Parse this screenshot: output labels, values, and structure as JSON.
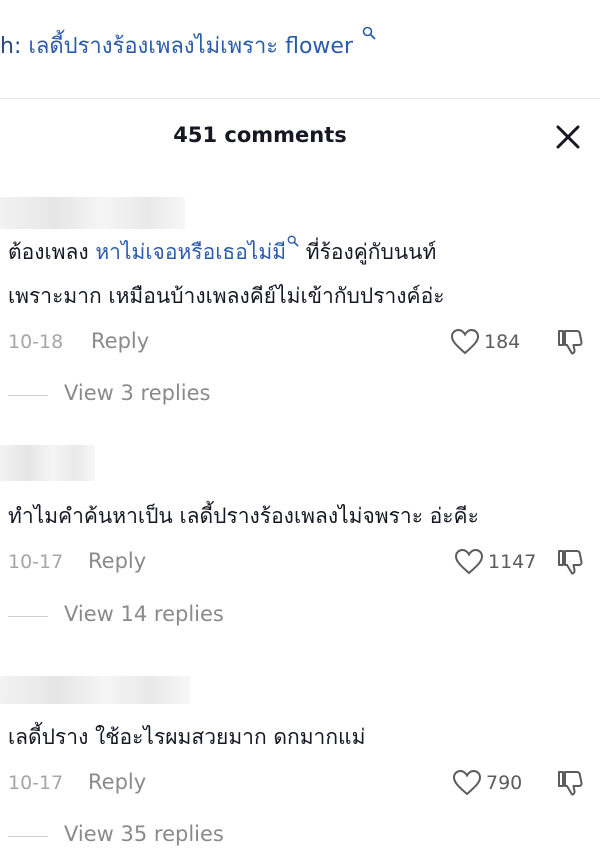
{
  "search": {
    "prefix": "h:",
    "query": "เลดี้ปรางร้องเพลงไม่เพราะ flower"
  },
  "comments_panel": {
    "title": "451 comments"
  },
  "comments": [
    {
      "text_part1": "ต้องเพลง ",
      "link": "หาไม่เจอหรือเธอไม่มี",
      "text_part2": " ที่ร้องคู่กับนนท์",
      "line2": "เพราะมาก เหมือนบ้างเพลงคีย์ไม่เข้ากับปรางค์อ่ะ",
      "date": "10-18",
      "reply_label": "Reply",
      "likes": "184",
      "view_replies": "View 3 replies"
    },
    {
      "text": "ทำไมคำค้นหาเป็น เลดี้ปรางร้องเพลงไม่จพราะ อ่ะคีะ",
      "date": "10-17",
      "reply_label": "Reply",
      "likes": "1147",
      "view_replies": "View 14 replies"
    },
    {
      "text": "เลดี้ปราง ใช้อะไรผมสวยมาก ดกมากแม่",
      "date": "10-17",
      "reply_label": "Reply",
      "likes": "790",
      "view_replies": "View 35 replies"
    }
  ],
  "colors": {
    "link": "#2b5cab",
    "muted": "#8a8a8a",
    "text": "#161823"
  },
  "icons": [
    "search-icon",
    "close-icon",
    "heart-icon",
    "dislike-icon"
  ]
}
